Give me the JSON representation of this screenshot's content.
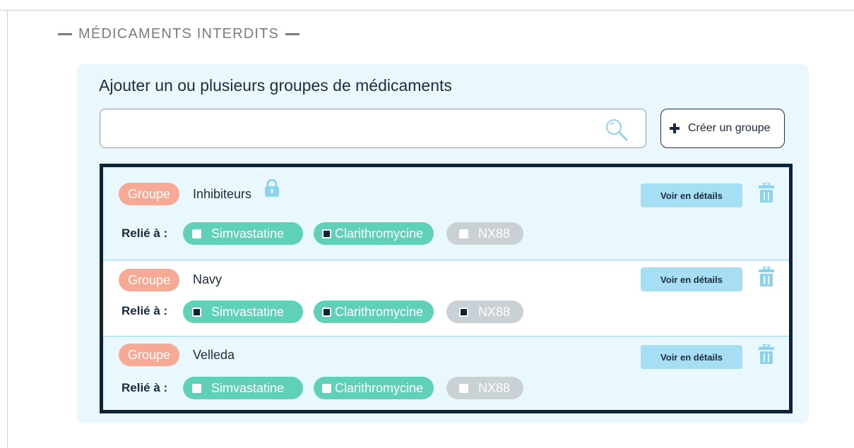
{
  "section": {
    "title": "MÉDICAMENTS INTERDITS"
  },
  "panel": {
    "heading": "Ajouter un ou plusieurs groupes de médicaments",
    "search": {
      "value": "",
      "placeholder": ""
    },
    "create_button": "Créer un groupe"
  },
  "groups": [
    {
      "badge": "Groupe",
      "name": "Inhibiteurs",
      "locked": true,
      "details_button": "Voir en détails",
      "linked_label": "Relié à :",
      "drugs": [
        {
          "label": "Simvastatine",
          "checked": false
        },
        {
          "label": "Clarithromycine",
          "checked": true
        },
        {
          "label": "NX88",
          "checked": false
        }
      ]
    },
    {
      "badge": "Groupe",
      "name": "Navy",
      "locked": false,
      "details_button": "Voir en détails",
      "linked_label": "Relié à :",
      "drugs": [
        {
          "label": "Simvastatine",
          "checked": true
        },
        {
          "label": "Clarithromycine",
          "checked": true
        },
        {
          "label": "NX88",
          "checked": true
        }
      ]
    },
    {
      "badge": "Groupe",
      "name": "Velleda",
      "locked": false,
      "details_button": "Voir en détails",
      "linked_label": "Relié à :",
      "drugs": [
        {
          "label": "Simvastatine",
          "checked": false
        },
        {
          "label": "Clarithromycine",
          "checked": false
        },
        {
          "label": "NX88",
          "checked": false
        }
      ]
    }
  ],
  "colors": {
    "accent_dark": "#0d2438",
    "badge": "#f6a994",
    "chip_active": "#5ed1b8",
    "chip_inactive": "#c9d1d4",
    "details_button": "#a6def3",
    "panel_background": "#eaf8fd"
  },
  "icons": [
    "search-icon",
    "plus-icon",
    "lock-icon",
    "trash-icon",
    "checkbox-icon"
  ]
}
